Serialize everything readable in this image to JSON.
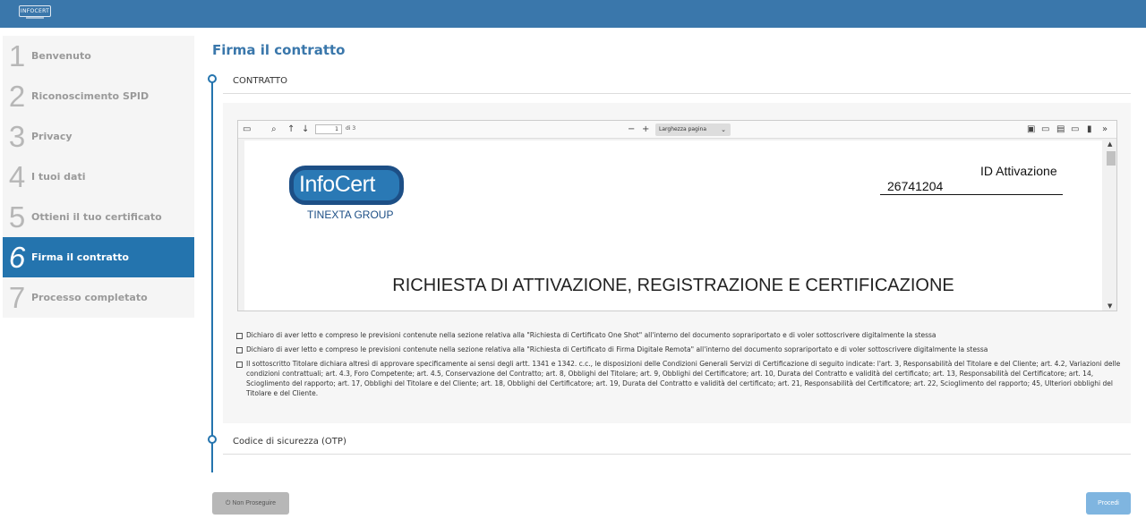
{
  "header": {
    "logo_text": "INFOCERT"
  },
  "sidebar": {
    "steps": [
      {
        "num": "1",
        "label": "Benvenuto"
      },
      {
        "num": "2",
        "label": "Riconoscimento SPID"
      },
      {
        "num": "3",
        "label": "Privacy"
      },
      {
        "num": "4",
        "label": "I tuoi dati"
      },
      {
        "num": "5",
        "label": "Ottieni il tuo certificato"
      },
      {
        "num": "6",
        "label": "Firma il contratto"
      },
      {
        "num": "7",
        "label": "Processo completato"
      }
    ],
    "active_step": 6
  },
  "main": {
    "title": "Firma il contratto",
    "section_contract": "CONTRATTO",
    "section_otp": "Codice di sicurezza (OTP)"
  },
  "viewer": {
    "page_number": "1",
    "page_count_label": "di 3",
    "zoom": "Larghezza pagina",
    "logo_text": "InfoCert",
    "logo_sub": "TINEXTA GROUP",
    "id_label": "ID Attivazione",
    "id_value": "26741204",
    "doc_title": "RICHIESTA DI ATTIVAZIONE, REGISTRAZIONE E CERTIFICAZIONE"
  },
  "checkboxes": [
    "Dichiaro di aver letto e compreso le previsioni contenute nella sezione relativa alla \"Richiesta di Certificato One Shot\" all'interno del documento soprariportato e di voler sottoscrivere digitalmente la stessa",
    "Dichiaro di aver letto e compreso le previsioni contenute nella sezione relativa alla \"Richiesta di Certificato di Firma Digitale Remota\" all'interno del documento soprariportato e di voler sottoscrivere digitalmente la stessa",
    "Il sottoscritto Titolare dichiara altresì di approvare specificamente ai sensi degli artt. 1341 e 1342. c.c., le disposizioni delle Condizioni Generali Servizi di Certificazione di seguito indicate: l'art. 3, Responsabilità del Titolare e del Cliente; art. 4.2, Variazioni delle condizioni contrattuali; art. 4.3, Foro Competente; art. 4.5, Conservazione del Contratto; art. 8, Obblighi del Titolare; art. 9, Obblighi del Certificatore; art. 10, Durata del Contratto e validità del certificato; art. 13, Responsabilità del Certificatore; art. 14, Scioglimento del rapporto; art. 17, Obblighi del Titolare e del Cliente; art. 18, Obblighi del Certificatore; art. 19, Durata del Contratto e validità del certificato; art. 21, Responsabilità del Certificatore; art. 22, Scioglimento del rapporto; 45, Ulteriori obblighi del Titolare e del Cliente."
  ],
  "buttons": {
    "cancel": "Non Proseguire",
    "proceed": "Procedi"
  },
  "colors": {
    "brand": "#3a77ab",
    "active": "#2474ae",
    "proceed": "#7fb5e0"
  }
}
